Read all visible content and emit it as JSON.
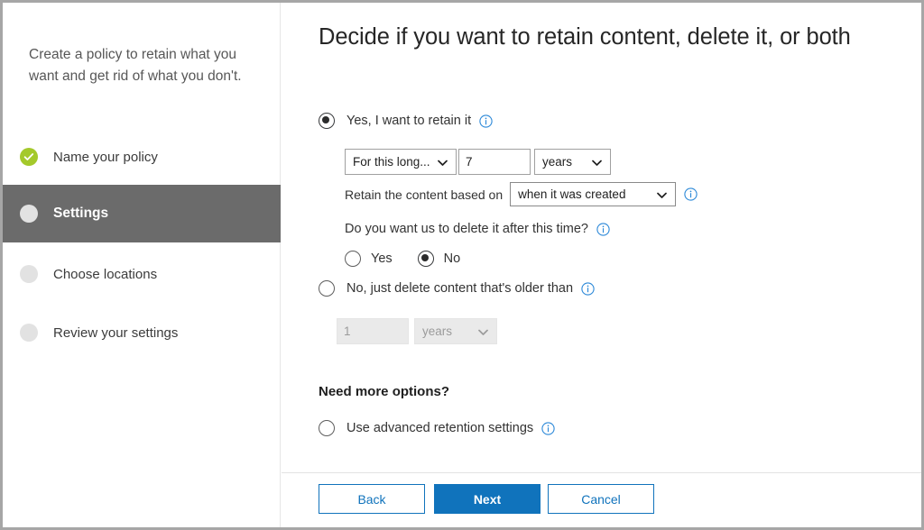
{
  "sidebar": {
    "intro": "Create a policy to retain what you want and get rid of what you don't.",
    "steps": [
      {
        "label": "Name your policy",
        "state": "done",
        "icon": "check-circle-icon"
      },
      {
        "label": "Settings",
        "state": "current",
        "icon": "circle-icon"
      },
      {
        "label": "Choose locations",
        "state": "todo",
        "icon": "circle-icon"
      },
      {
        "label": "Review your settings",
        "state": "todo",
        "icon": "circle-icon"
      }
    ]
  },
  "main": {
    "title": "Decide if you want to retain content, delete it, or both",
    "retain": {
      "label": "Yes, I want to retain it",
      "selected": true,
      "info_icon": "info-icon",
      "duration_mode": "For this long...",
      "duration_value": "7",
      "duration_unit": "years",
      "based_on_label": "Retain the content based on",
      "based_on_value": "when it was created",
      "based_on_info_icon": "info-icon",
      "delete_after_question": "Do you want us to delete it after this time?",
      "delete_after_info_icon": "info-icon",
      "yes_label": "Yes",
      "no_label": "No",
      "yes_selected": false,
      "no_selected": true
    },
    "delete_only": {
      "label": "No, just delete content that's older than",
      "selected": false,
      "info_icon": "info-icon",
      "value": "1",
      "unit": "years",
      "disabled": true
    },
    "more_options": {
      "title": "Need more options?",
      "advanced_label": "Use advanced retention settings",
      "advanced_selected": false,
      "info_icon": "info-icon"
    }
  },
  "footer": {
    "back_label": "Back",
    "next_label": "Next",
    "cancel_label": "Cancel",
    "primary_color": "#1073bc"
  }
}
